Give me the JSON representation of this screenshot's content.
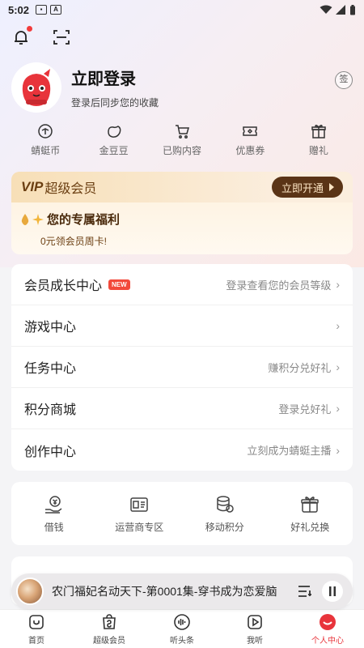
{
  "status_bar": {
    "time": "5:02"
  },
  "profile": {
    "title": "立即登录",
    "subtitle": "登录后同步您的收藏",
    "signin_label": "签"
  },
  "quick_actions": [
    {
      "label": "蜻蜓币",
      "icon": "coin-icon"
    },
    {
      "label": "金豆豆",
      "icon": "bean-icon"
    },
    {
      "label": "已购内容",
      "icon": "cart-icon"
    },
    {
      "label": "优惠券",
      "icon": "coupon-icon"
    },
    {
      "label": "赠礼",
      "icon": "gift-icon"
    }
  ],
  "vip": {
    "badge": "VIP",
    "title": "超级会员",
    "button": "立即开通",
    "benefit_title": "您的专属福利",
    "weekly_card": "0元领会员周卡!"
  },
  "menu": [
    {
      "title": "会员成长中心",
      "badge": "NEW",
      "hint": "登录查看您的会员等级"
    },
    {
      "title": "游戏中心",
      "badge": "",
      "hint": ""
    },
    {
      "title": "任务中心",
      "badge": "",
      "hint": "赚积分兑好礼"
    },
    {
      "title": "积分商城",
      "badge": "",
      "hint": "登录兑好礼"
    },
    {
      "title": "创作中心",
      "badge": "",
      "hint": "立刻成为蜻蜓主播"
    }
  ],
  "services": [
    {
      "label": "借钱",
      "icon": "loan-icon"
    },
    {
      "label": "运营商专区",
      "icon": "carrier-icon"
    },
    {
      "label": "移动积分",
      "icon": "points-icon"
    },
    {
      "label": "好礼兑换",
      "icon": "gift-exchange-icon"
    }
  ],
  "player": {
    "title": "农门福妃名动天下-第0001集-穿书成为恋爱脑"
  },
  "bottom_nav": [
    {
      "label": "首页",
      "icon": "home-icon",
      "active": false
    },
    {
      "label": "超级会员",
      "icon": "vip-bag-icon",
      "active": false
    },
    {
      "label": "听头条",
      "icon": "news-audio-icon",
      "active": false
    },
    {
      "label": "我听",
      "icon": "play-list-icon",
      "active": false
    },
    {
      "label": "个人中心",
      "icon": "profile-icon",
      "active": true
    }
  ],
  "colors": {
    "accent": "#e8343b",
    "vip_dark": "#5a3416",
    "vip_light": "#fbe4c3"
  }
}
